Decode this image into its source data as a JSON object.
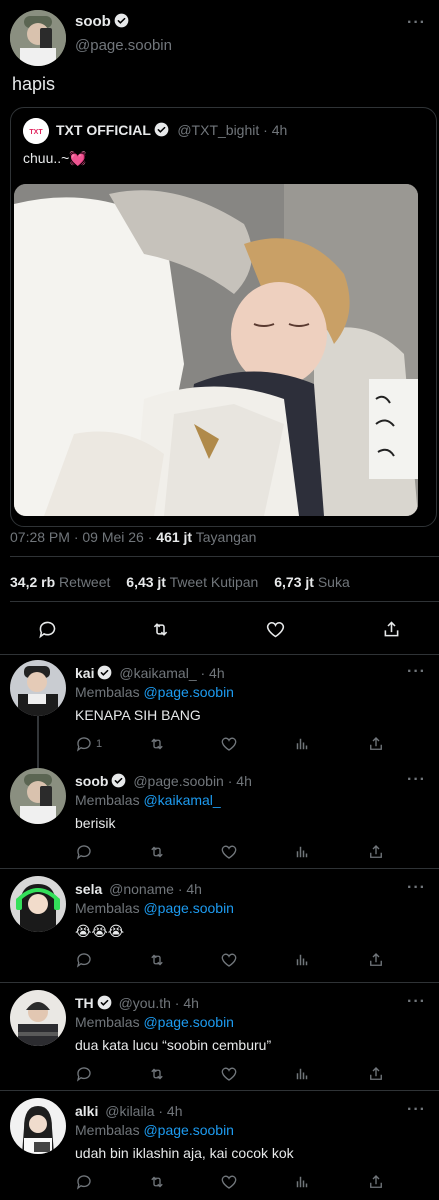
{
  "main_tweet": {
    "display_name": "soob",
    "handle": "@page.soobin",
    "text": "hapis",
    "timestamp": "07:28 PM · 09 Mei 26 · ",
    "views_count": "461 jt",
    "views_label": " Tayangan",
    "retweets_count": "34,2 rb",
    "retweets_label": " Retweet",
    "quotes_count": "6,43 jt",
    "quotes_label": " Tweet Kutipan",
    "likes_count": "6,73 jt",
    "likes_label": " Suka"
  },
  "quoted_tweet": {
    "display_name": "TXT OFFICIAL",
    "handle": "@TXT_bighit · 4h",
    "text": "chuu..~💓"
  },
  "replies": [
    {
      "display_name": "kai",
      "verified": true,
      "handle": "@kaikamal_ · 4h",
      "reply_prefix": "Membalas ",
      "reply_to": "@page.soobin",
      "text": "KENAPA SIH BANG",
      "reply_count": "1"
    },
    {
      "display_name": "soob",
      "verified": true,
      "handle": "@page.soobin · 4h",
      "reply_prefix": "Membalas ",
      "reply_to": "@kaikamal_",
      "text": "berisik",
      "reply_count": ""
    },
    {
      "display_name": "sela",
      "verified": false,
      "handle": "@noname · 4h",
      "reply_prefix": "Membalas ",
      "reply_to": "@page.soobin",
      "text": "😭😭😭",
      "reply_count": ""
    },
    {
      "display_name": "TH",
      "verified": true,
      "handle": "@you.th · 4h",
      "reply_prefix": "Membalas ",
      "reply_to": "@page.soobin",
      "text": "dua kata lucu “soobin cemburu”",
      "reply_count": ""
    },
    {
      "display_name": "alki",
      "verified": false,
      "handle": "@kilaila · 4h",
      "reply_prefix": "Membalas ",
      "reply_to": "@page.soobin",
      "text": "udah bin iklashin aja, kai cocok kok",
      "reply_count": ""
    }
  ],
  "colors": {
    "background": "#000000",
    "text": "#e7e9ea",
    "muted": "#71767b",
    "link": "#1d9bf0",
    "divider": "#2f3336"
  }
}
